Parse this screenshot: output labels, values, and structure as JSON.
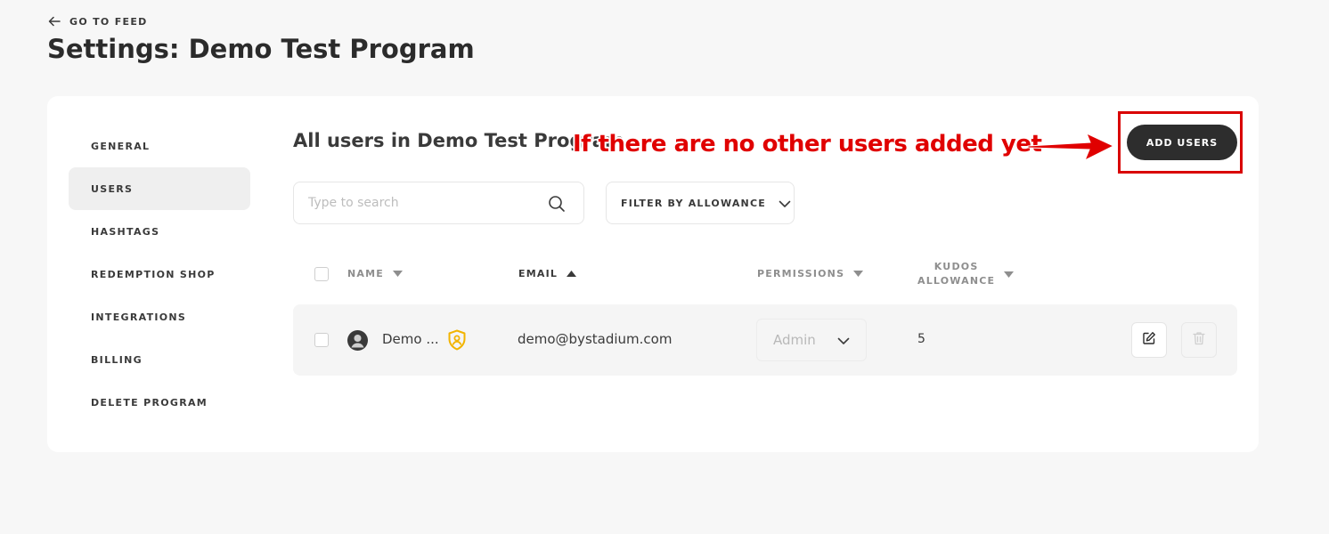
{
  "header": {
    "back_label": "GO TO FEED",
    "title": "Settings: Demo Test Program"
  },
  "sidebar": {
    "items": [
      {
        "label": "GENERAL",
        "active": false
      },
      {
        "label": "USERS",
        "active": true
      },
      {
        "label": "HASHTAGS",
        "active": false
      },
      {
        "label": "REDEMPTION SHOP",
        "active": false
      },
      {
        "label": "INTEGRATIONS",
        "active": false
      },
      {
        "label": "BILLING",
        "active": false
      },
      {
        "label": "DELETE PROGRAM",
        "active": false
      }
    ]
  },
  "main": {
    "section_title": "All users in Demo Test Program",
    "search_placeholder": "Type to search",
    "filter_label": "FILTER BY ALLOWANCE",
    "add_users_label": "ADD USERS",
    "columns": {
      "name": "NAME",
      "email": "EMAIL",
      "permissions": "PERMISSIONS",
      "kudos_line1": "KUDOS",
      "kudos_line2": "ALLOWANCE"
    },
    "rows": [
      {
        "name": "Demo ...",
        "email": "demo@bystadium.com",
        "permission": "Admin",
        "allowance": "5"
      }
    ]
  },
  "annotation": {
    "text": "If there are no other users added yet",
    "color": "#e00000"
  },
  "colors": {
    "primary_button": "#2d2d2d",
    "admin_badge": "#f2b400",
    "highlight": "#d90000"
  }
}
